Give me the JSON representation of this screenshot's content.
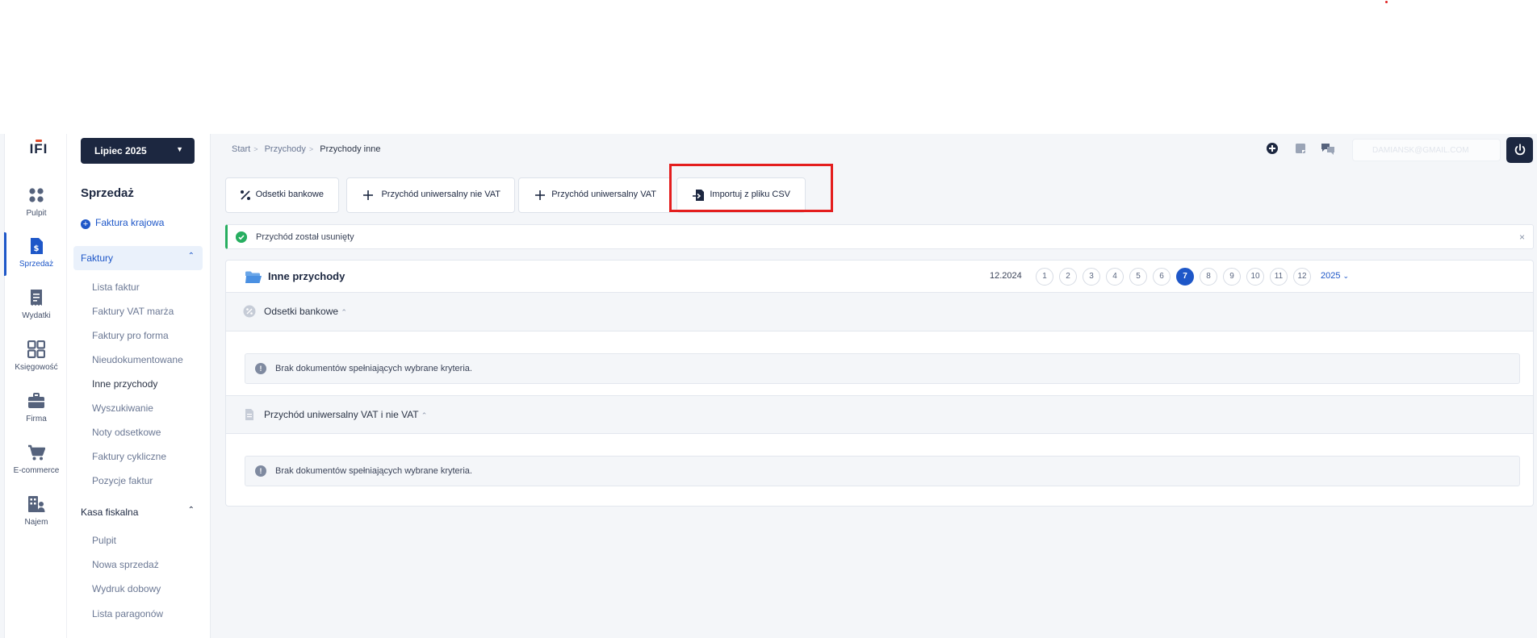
{
  "breadcrumb": [
    "Start",
    "Przychody",
    "Przychody inne"
  ],
  "rail": [
    {
      "label": "Pulpit",
      "icon": "dashboard-icon"
    },
    {
      "label": "Sprzedaż",
      "icon": "invoice-dollar-icon"
    },
    {
      "label": "Wydatki",
      "icon": "receipt-icon"
    },
    {
      "label": "Księgowość",
      "icon": "grid-icon"
    },
    {
      "label": "Firma",
      "icon": "briefcase-icon"
    },
    {
      "label": "E-commerce",
      "icon": "cart-icon"
    },
    {
      "label": "Najem",
      "icon": "building-person-icon"
    }
  ],
  "logo": "IFI",
  "sidebar": {
    "month": "Lipiec 2025",
    "title": "Sprzedaż",
    "new_invoice": "Faktura krajowa",
    "groups": [
      {
        "label": "Faktury",
        "items": [
          "Lista faktur",
          "Faktury VAT marża",
          "Faktury pro forma",
          "Nieudokumentowane",
          "Inne przychody",
          "Wyszukiwanie",
          "Noty odsetkowe",
          "Faktury cykliczne",
          "Pozycje faktur"
        ]
      },
      {
        "label": "Kasa fiskalna",
        "items": [
          "Pulpit",
          "Nowa sprzedaż",
          "Wydruk dobowy",
          "Lista paragonów"
        ]
      }
    ]
  },
  "user": {
    "email_masked": "DAMIANSK@GMAIL.COM"
  },
  "actions": [
    "Odsetki bankowe",
    "Przychód uniwersalny nie VAT",
    "Przychód uniwersalny VAT",
    "Importuj z pliku CSV"
  ],
  "alert": {
    "text": "Przychód został usunięty",
    "close": "×"
  },
  "panel": {
    "title": "Inne przychody",
    "period": "12.2024",
    "months": [
      "1",
      "2",
      "3",
      "4",
      "5",
      "6",
      "7",
      "8",
      "9",
      "10",
      "11",
      "12"
    ],
    "active_month": "7",
    "year": "2025",
    "sections": [
      {
        "title": "Odsetki bankowe",
        "empty": "Brak dokumentów spełniających wybrane kryteria."
      },
      {
        "title": "Przychód uniwersalny VAT i nie VAT",
        "empty": "Brak dokumentów spełniających wybrane kryteria."
      }
    ]
  },
  "colors": {
    "accent": "#1e57c8",
    "navy": "#1c2740",
    "success": "#27ae60",
    "highlight": "#e41e1e"
  }
}
